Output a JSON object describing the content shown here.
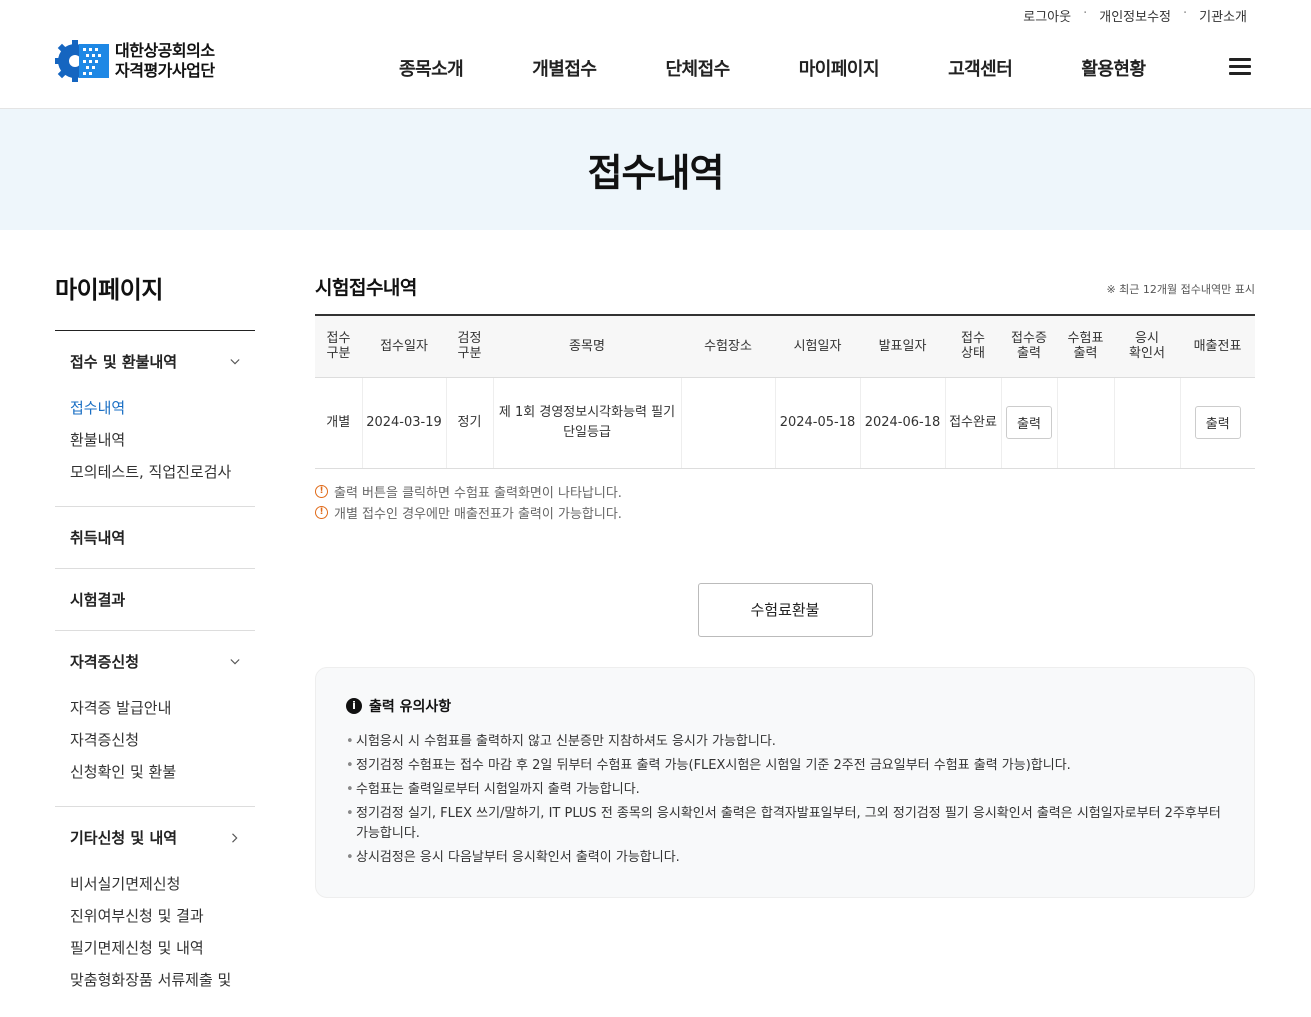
{
  "header": {
    "util_links": [
      "로그아웃",
      "개인정보수정",
      "기관소개"
    ],
    "logo_line1": "대한상공회의소",
    "logo_line2": "자격평가사업단",
    "menu": [
      "종목소개",
      "개별접수",
      "단체접수",
      "마이페이지",
      "고객센터",
      "활용현황"
    ],
    "hamburger_icon": "menu-icon"
  },
  "banner": {
    "title": "접수내역"
  },
  "sidebar": {
    "title": "마이페이지",
    "groups": [
      {
        "label": "접수 및 환불내역",
        "chevron": "down",
        "items": [
          "접수내역",
          "환불내역",
          "모의테스트, 직업진로검사"
        ],
        "active": 0
      },
      {
        "label": "취득내역"
      },
      {
        "label": "시험결과"
      },
      {
        "label": "자격증신청",
        "chevron": "down",
        "items": [
          "자격증 발급안내",
          "자격증신청",
          "신청확인 및 환불"
        ]
      },
      {
        "label": "기타신청 및 내역",
        "chevron": "right",
        "items": [
          "비서실기면제신청",
          "진위여부신청 및 결과",
          "필기면제신청 및 내역",
          "맞춤형화장품 서류제출 및"
        ]
      }
    ]
  },
  "main": {
    "title": "시험접수내역",
    "note": "※ 최근 12개월 접수내역만 표시",
    "columns": [
      "접수\n구분",
      "접수일자",
      "검정\n구분",
      "종목명",
      "수험장소",
      "시험일자",
      "발표일자",
      "접수\n상태",
      "접수증\n출력",
      "수험표\n출력",
      "응시\n확인서",
      "매출전표"
    ],
    "rows": [
      {
        "type": "개별",
        "date": "2024-03-19",
        "exam_kind": "정기",
        "subject": "제 1회 경영정보시각화능력 필기 단일등급",
        "place": "",
        "exam_date": "2024-05-18",
        "announce_date": "2024-06-18",
        "status": "접수완료",
        "receipt_btn": "출력",
        "ticket_btn": "",
        "confirm_btn": "",
        "sales_btn": "출력"
      }
    ],
    "notes": [
      "출력 버튼을 클릭하면 수험표 출력화면이 나타납니다.",
      "개별 접수인 경우에만 매출전표가 출력이 가능합니다."
    ],
    "refund_button": "수험료환불",
    "caution": {
      "title": "출력 유의사항",
      "items": [
        "시험응시 시 수험표를 출력하지 않고 신분증만 지참하셔도 응시가 가능합니다.",
        "정기검정 수험표는 접수 마감 후 2일 뒤부터 수험표 출력 가능(FLEX시험은 시험일 기준 2주전 금요일부터 수험표 출력 가능)합니다.",
        "수험표는 출력일로부터 시험일까지 출력 가능합니다.",
        "정기검정 실기, FLEX 쓰기/말하기, IT PLUS 전 종목의 응시확인서 출력은 합격자발표일부터, 그외 정기검정 필기 응시확인서 출력은 시험일자로부터 2주후부터 가능합니다.",
        "상시검정은 응시 다음날부터 응시확인서 출력이 가능합니다."
      ]
    }
  },
  "colors": {
    "accent": "#1a6fc4",
    "logo_blue": "#1565c0",
    "banner_bg": "#eef6fb",
    "warn": "#e06b1a"
  }
}
